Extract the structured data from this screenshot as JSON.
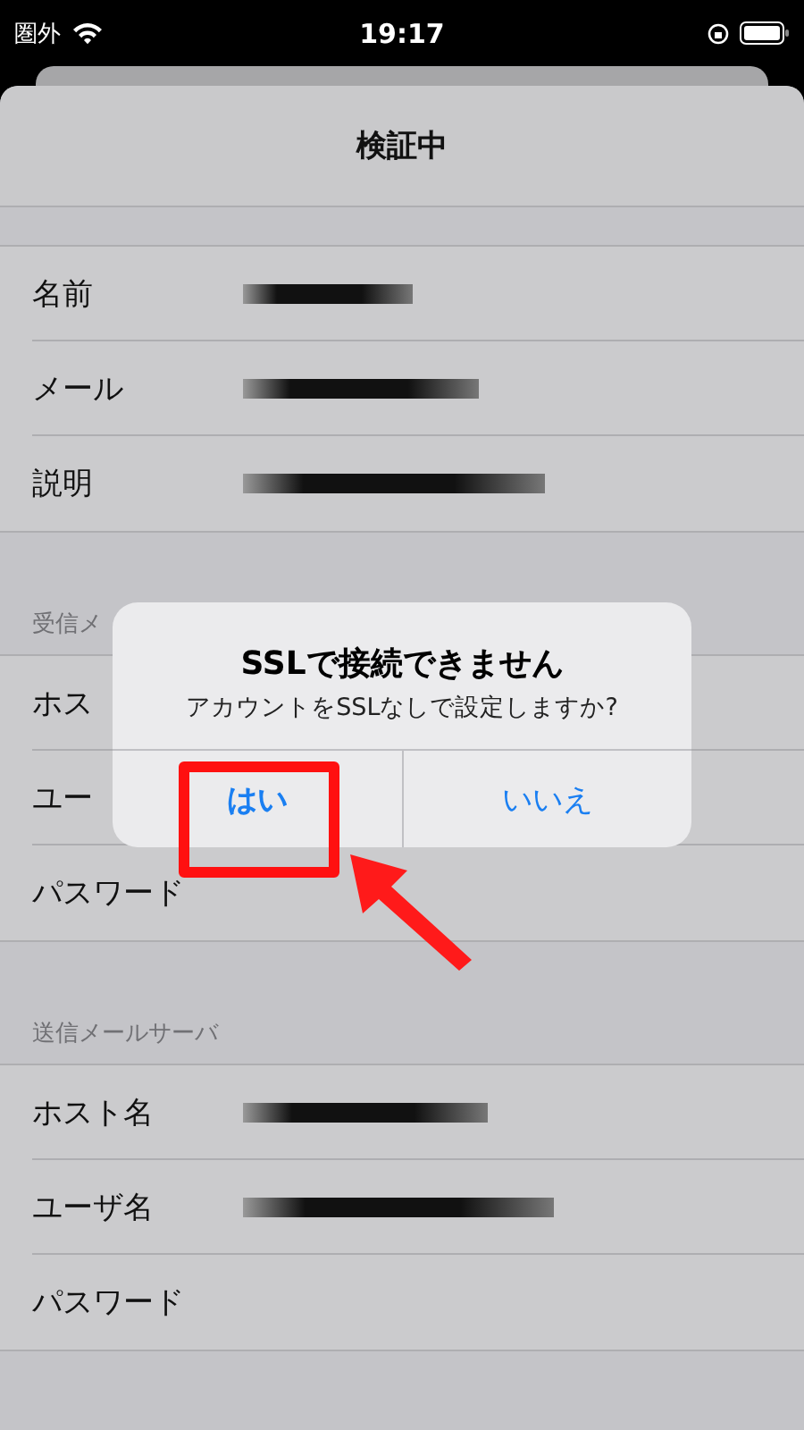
{
  "status_bar": {
    "carrier": "圏外",
    "time": "19:17"
  },
  "sheet": {
    "title": "検証中",
    "groups": [
      {
        "rows": [
          {
            "label": "名前",
            "redacted": true
          },
          {
            "label": "メール",
            "redacted": true
          },
          {
            "label": "説明",
            "redacted": true
          }
        ]
      },
      {
        "header": "受信メ",
        "rows": [
          {
            "label": "ホス",
            "redacted": false
          },
          {
            "label": "ユー",
            "redacted": false
          },
          {
            "label": "パスワード",
            "redacted": false
          }
        ]
      },
      {
        "header": "送信メールサーバ",
        "rows": [
          {
            "label": "ホスト名",
            "redacted": true
          },
          {
            "label": "ユーザ名",
            "redacted": true
          },
          {
            "label": "パスワード",
            "redacted": false
          }
        ]
      }
    ]
  },
  "alert": {
    "title": "SSLで接続できません",
    "message": "アカウントをSSLなしで設定しますか?",
    "buttons": [
      {
        "label": "はい",
        "bold": true,
        "highlighted": true
      },
      {
        "label": "いいえ",
        "bold": false,
        "highlighted": false
      }
    ]
  }
}
